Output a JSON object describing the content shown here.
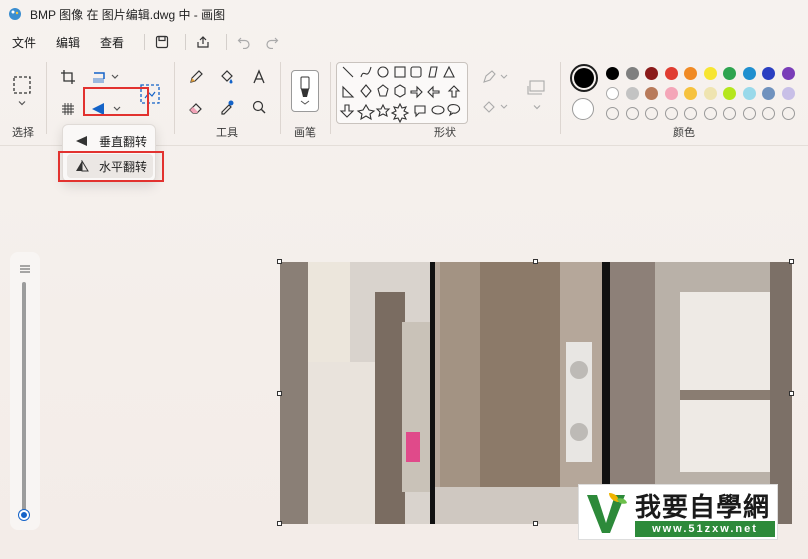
{
  "window": {
    "title": "BMP 图像 在 图片编辑.dwg 中 - 画图"
  },
  "menu": {
    "file": "文件",
    "edit": "编辑",
    "view": "查看"
  },
  "ribbon": {
    "groups": {
      "select": "选择",
      "tools": "工具",
      "brushes": "画笔",
      "shapes": "形状",
      "colors": "颜色"
    }
  },
  "rotate_menu": {
    "items": [
      {
        "label": "垂直翻转"
      },
      {
        "label": "水平翻转"
      }
    ]
  },
  "colors": {
    "primary": "#000000",
    "secondary": "#ffffff",
    "row1": [
      "#000000",
      "#7f7f7f",
      "#8b1a1a",
      "#e03c31",
      "#f08a24",
      "#f7e531",
      "#2ea44f",
      "#1f8fcf",
      "#2b3fc1",
      "#7a3db8"
    ],
    "row2": [
      "#ffffff",
      "#c3c3c3",
      "#b87a5a",
      "#f4a6b8",
      "#f6c23e",
      "#efe4b0",
      "#b5e61d",
      "#99d9ea",
      "#7092be",
      "#c8bfe7"
    ],
    "highlight": "#e2322f"
  },
  "logo": {
    "brand": "我要自學網",
    "url": "www.51zxw.net"
  }
}
